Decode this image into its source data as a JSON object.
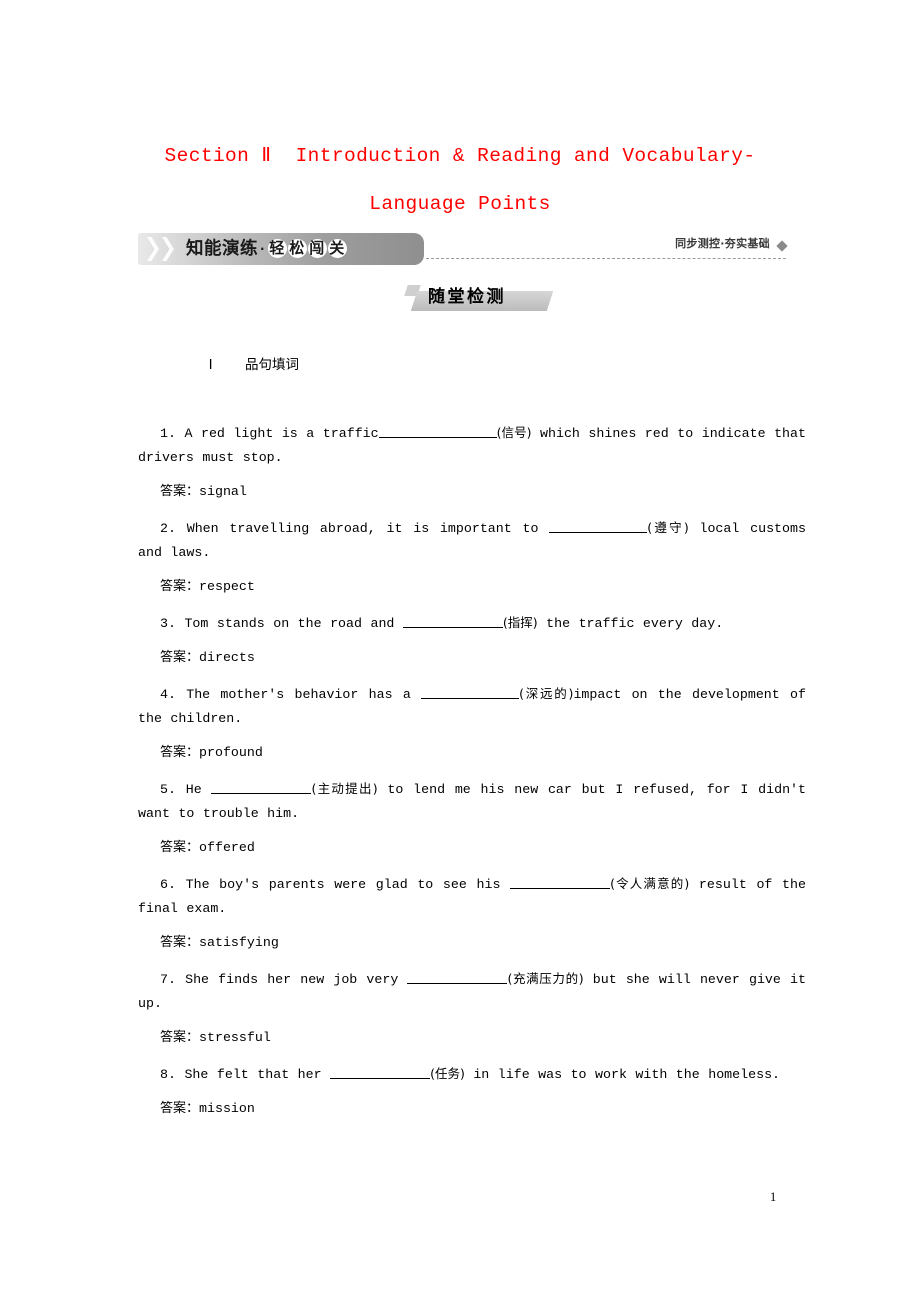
{
  "title": "Section Ⅱ  Introduction & Reading and Vocabulary-Language Points",
  "banner": {
    "left_label_1": "知能演练",
    "left_dot": "·",
    "left_label_2_chars": [
      "轻",
      "松",
      "闯",
      "关"
    ],
    "right_label": "同步测控·夯实基础",
    "sub_label": "随堂检测"
  },
  "section": {
    "numeral": "Ⅰ",
    "heading": "品句填词",
    "answer_prefix": "答案："
  },
  "questions": [
    {
      "number": "1.",
      "before": " A red light is a traffic",
      "blank_width": 118,
      "hint": "(信号)",
      "after": " which shines red to indicate that drivers must stop.",
      "answer": "signal"
    },
    {
      "number": "2.",
      "before": " When travelling abroad, it is important to ",
      "blank_width": 98,
      "hint": "(遵守)",
      "after": " local customs and laws.",
      "answer": "respect"
    },
    {
      "number": "3.",
      "before": " Tom stands on the road and ",
      "blank_width": 100,
      "hint": "(指挥)",
      "after": " the traffic every day.",
      "answer": "directs"
    },
    {
      "number": "4.",
      "before": " The mother's behavior has a ",
      "blank_width": 98,
      "hint": "(深远的)",
      "after": "impact on the development of the children.",
      "answer": "profound"
    },
    {
      "number": "5.",
      "before": " He ",
      "blank_width": 100,
      "hint": "(主动提出)",
      "after": " to lend me his new car but I refused, for I didn't want to trouble him.",
      "answer": "offered"
    },
    {
      "number": "6.",
      "before": " The boy's parents were glad to see his ",
      "blank_width": 100,
      "hint": "(令人满意的)",
      "after": " result of the final exam.",
      "answer": "satisfying"
    },
    {
      "number": "7.",
      "before": " She finds her new job very ",
      "blank_width": 100,
      "hint": "(充满压力的)",
      "after": " but she will never give it up.",
      "answer": "stressful"
    },
    {
      "number": "8.",
      "before": " She felt that her ",
      "blank_width": 100,
      "hint": "(任务)",
      "after": " in life was to work with the homeless.",
      "answer": "mission"
    }
  ],
  "footer": {
    "page_number": "1"
  }
}
